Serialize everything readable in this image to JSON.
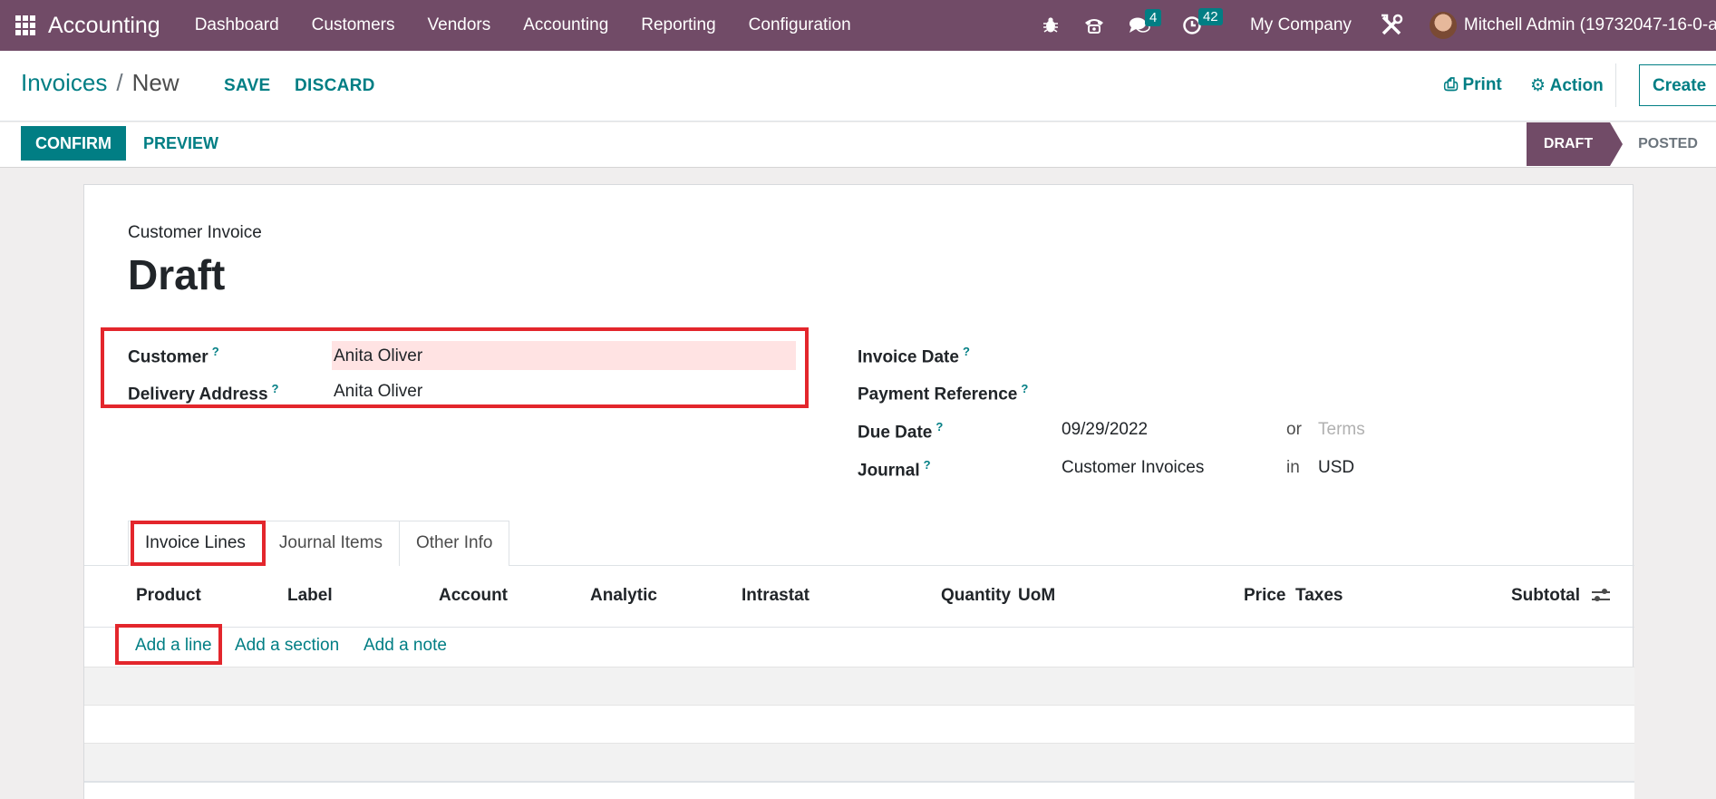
{
  "navbar": {
    "app_name": "Accounting",
    "menu": [
      "Dashboard",
      "Customers",
      "Vendors",
      "Accounting",
      "Reporting",
      "Configuration"
    ],
    "messages_count": "4",
    "activities_count": "42",
    "company": "My Company",
    "user": "Mitchell Admin (19732047-16-0-al"
  },
  "breadcrumb": {
    "parent": "Invoices",
    "separator": "/",
    "current": "New"
  },
  "actions": {
    "save": "SAVE",
    "discard": "DISCARD",
    "print": "Print",
    "action": "Action",
    "create": "Create"
  },
  "statusbar": {
    "confirm": "CONFIRM",
    "preview": "PREVIEW",
    "stages": [
      "DRAFT",
      "POSTED"
    ],
    "active_stage": "DRAFT"
  },
  "form": {
    "doc_type": "Customer Invoice",
    "title": "Draft",
    "help_mark": "?",
    "customer_label": "Customer",
    "customer_value": "Anita Oliver",
    "delivery_label": "Delivery Address",
    "delivery_value": "Anita Oliver",
    "invoice_date_label": "Invoice Date",
    "payment_ref_label": "Payment Reference",
    "due_date_label": "Due Date",
    "due_date_value": "09/29/2022",
    "or_text": "or",
    "terms_placeholder": "Terms",
    "journal_label": "Journal",
    "journal_value": "Customer Invoices",
    "in_text": "in",
    "currency": "USD"
  },
  "tabs": [
    "Invoice Lines",
    "Journal Items",
    "Other Info"
  ],
  "table": {
    "columns": [
      "Product",
      "Label",
      "Account",
      "Analytic",
      "Intrastat",
      "Quantity",
      "UoM",
      "Price",
      "Taxes",
      "Subtotal"
    ],
    "add_line": "Add a line",
    "add_section": "Add a section",
    "add_note": "Add a note"
  },
  "colors": {
    "primary": "#714b67",
    "accent": "#017e84",
    "highlight": "#e3262c",
    "required": "#ffe3e3"
  }
}
